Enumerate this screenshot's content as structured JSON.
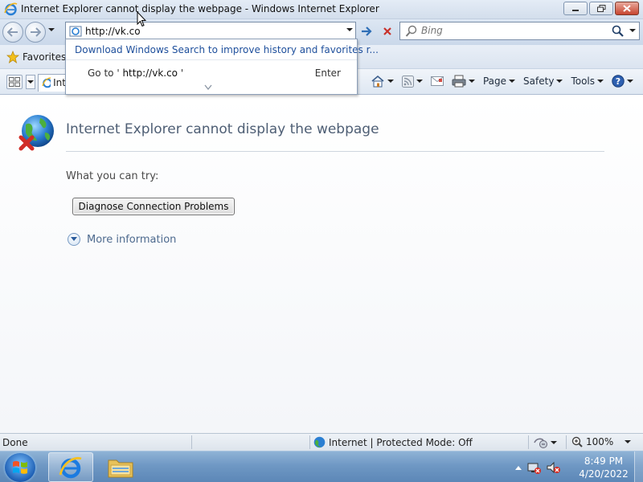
{
  "window": {
    "title": "Internet Explorer cannot display the webpage - Windows Internet Explorer"
  },
  "address_bar": {
    "url": "http://vk.co"
  },
  "search_box": {
    "placeholder": "Bing"
  },
  "autocomplete": {
    "suggestion_link": "Download Windows Search to improve history and favorites r...",
    "goto_prefix": "Go to '",
    "goto_url": "http://vk.co",
    "goto_suffix": "'",
    "enter_label": "Enter"
  },
  "favorites_bar": {
    "favorites_label": "Favorites"
  },
  "tab": {
    "title": "Int"
  },
  "command_bar": {
    "page_label": "Page",
    "safety_label": "Safety",
    "tools_label": "Tools"
  },
  "error_page": {
    "title": "Internet Explorer cannot display the webpage",
    "what_you_can_try": "What you can try:",
    "diagnose_button": "Diagnose Connection Problems",
    "more_information": "More information"
  },
  "status_bar": {
    "status": "Done",
    "zone": "Internet | Protected Mode: Off",
    "zoom": "100%"
  },
  "taskbar": {
    "time": "8:49 PM",
    "date": "4/20/2022"
  },
  "colors": {
    "error_title": "#4e5e74",
    "link": "#1e4f9c",
    "taskbar": "#6f98c4"
  }
}
